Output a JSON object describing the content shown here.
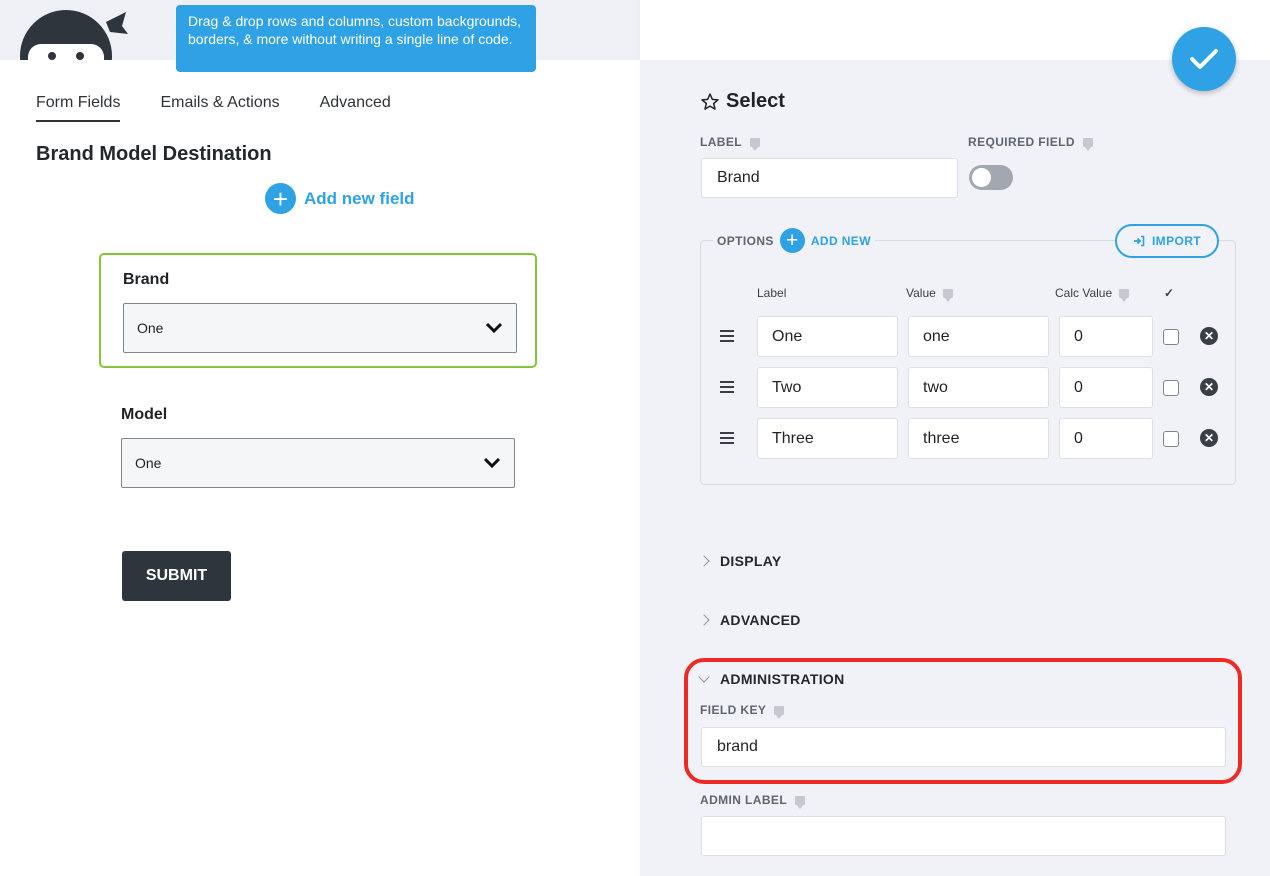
{
  "tooltip": {
    "text": "Drag & drop rows and columns, custom backgrounds, borders, & more without writing a single line of code."
  },
  "tabs": [
    {
      "label": "Form Fields"
    },
    {
      "label": "Emails & Actions"
    },
    {
      "label": "Advanced"
    }
  ],
  "form": {
    "title": "Brand Model Destination",
    "add_field_label": "Add new field",
    "fields": [
      {
        "label": "Brand",
        "selected_value": "One"
      },
      {
        "label": "Model",
        "selected_value": "One"
      }
    ],
    "submit_label": "SUBMIT"
  },
  "drawer": {
    "title": "Select",
    "label_caption": "LABEL",
    "label_value": "Brand",
    "required_caption": "REQUIRED FIELD",
    "required_on": false,
    "options": {
      "caption": "OPTIONS",
      "add_new_label": "ADD NEW",
      "import_label": "IMPORT",
      "col_label": "Label",
      "col_value": "Value",
      "col_calc": "Calc Value",
      "col_check": "✓",
      "rows": [
        {
          "label": "One",
          "value": "one",
          "calc": "0"
        },
        {
          "label": "Two",
          "value": "two",
          "calc": "0"
        },
        {
          "label": "Three",
          "value": "three",
          "calc": "0"
        }
      ]
    },
    "sections": {
      "display": "DISPLAY",
      "advanced": "ADVANCED",
      "administration": "ADMINISTRATION"
    },
    "field_key_caption": "FIELD KEY",
    "field_key_value": "brand",
    "admin_label_caption": "ADMIN LABEL",
    "admin_label_value": ""
  },
  "colors": {
    "accent": "#2ea2e4",
    "selected_border": "#85c43c",
    "highlight": "#ef2a25",
    "submit_bg": "#2f353c"
  }
}
